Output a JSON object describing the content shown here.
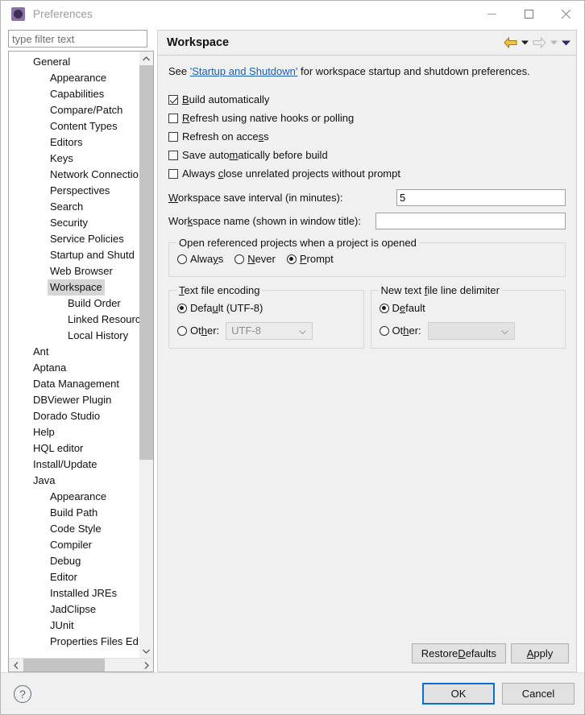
{
  "window": {
    "title": "Preferences",
    "app_icon": "preferences-gear-icon",
    "controls": {
      "minimize": "minimize-icon",
      "maximize": "maximize-icon",
      "close": "close-icon"
    }
  },
  "filter": {
    "placeholder": "type filter text",
    "value": ""
  },
  "tree": {
    "selected": "Workspace",
    "items": [
      {
        "label": "General",
        "level": 0
      },
      {
        "label": "Appearance",
        "level": 1
      },
      {
        "label": "Capabilities",
        "level": 1
      },
      {
        "label": "Compare/Patch",
        "level": 1
      },
      {
        "label": "Content Types",
        "level": 1
      },
      {
        "label": "Editors",
        "level": 1
      },
      {
        "label": "Keys",
        "level": 1
      },
      {
        "label": "Network Connectio",
        "level": 1
      },
      {
        "label": "Perspectives",
        "level": 1
      },
      {
        "label": "Search",
        "level": 1
      },
      {
        "label": "Security",
        "level": 1
      },
      {
        "label": "Service Policies",
        "level": 1
      },
      {
        "label": "Startup and Shutd",
        "level": 1
      },
      {
        "label": "Web Browser",
        "level": 1
      },
      {
        "label": "Workspace",
        "level": 1,
        "selected": true
      },
      {
        "label": "Build Order",
        "level": 2
      },
      {
        "label": "Linked Resourc",
        "level": 2
      },
      {
        "label": "Local History",
        "level": 2
      },
      {
        "label": "Ant",
        "level": 0
      },
      {
        "label": "Aptana",
        "level": 0
      },
      {
        "label": "Data Management",
        "level": 0
      },
      {
        "label": "DBViewer Plugin",
        "level": 0
      },
      {
        "label": "Dorado Studio",
        "level": 0
      },
      {
        "label": "Help",
        "level": 0
      },
      {
        "label": "HQL editor",
        "level": 0
      },
      {
        "label": "Install/Update",
        "level": 0
      },
      {
        "label": "Java",
        "level": 0
      },
      {
        "label": "Appearance",
        "level": 1
      },
      {
        "label": "Build Path",
        "level": 1
      },
      {
        "label": "Code Style",
        "level": 1
      },
      {
        "label": "Compiler",
        "level": 1
      },
      {
        "label": "Debug",
        "level": 1
      },
      {
        "label": "Editor",
        "level": 1
      },
      {
        "label": "Installed JREs",
        "level": 1
      },
      {
        "label": "JadClipse",
        "level": 1
      },
      {
        "label": "JUnit",
        "level": 1
      },
      {
        "label": "Properties Files Ed",
        "level": 1
      }
    ]
  },
  "page": {
    "title": "Workspace",
    "nav": {
      "back_icon": "back-arrow-icon",
      "back_caret_icon": "chevron-down-icon",
      "forward_icon": "forward-arrow-icon",
      "forward_caret_icon": "chevron-down-icon",
      "menu_caret_icon": "chevron-down-icon"
    },
    "intro": {
      "before": "See ",
      "link": "'Startup and Shutdown'",
      "after": " for workspace startup and shutdown preferences."
    },
    "checkboxes": [
      {
        "label_pre": "",
        "mnemonic": "B",
        "label_post": "uild automatically",
        "checked": true
      },
      {
        "label_pre": "",
        "mnemonic": "R",
        "label_post": "efresh using native hooks or polling",
        "checked": false
      },
      {
        "label_pre": "Refresh on acce",
        "mnemonic": "s",
        "label_post": "s",
        "checked": false
      },
      {
        "label_pre": "Save auto",
        "mnemonic": "m",
        "label_post": "atically before build",
        "checked": false
      },
      {
        "label_pre": "Always ",
        "mnemonic": "c",
        "label_post": "lose unrelated projects without prompt",
        "checked": false
      }
    ],
    "fields": [
      {
        "label_pre": "",
        "mnemonic": "W",
        "label_post": "orkspace save interval (in minutes):",
        "value": "5",
        "name": "workspace-save-interval"
      },
      {
        "label_pre": "Wor",
        "mnemonic": "k",
        "label_post": "space name (shown in window title):",
        "value": "",
        "name": "workspace-name"
      }
    ],
    "open_referenced": {
      "legend": "Open referenced projects when a project is opened",
      "options": [
        {
          "label_pre": "Alwa",
          "mnemonic": "y",
          "label_post": "s",
          "selected": false
        },
        {
          "label_pre": "",
          "mnemonic": "N",
          "label_post": "ever",
          "selected": false
        },
        {
          "label_pre": "",
          "mnemonic": "P",
          "label_post": "rompt",
          "selected": true
        }
      ]
    },
    "text_file_encoding": {
      "legend_pre": "",
      "legend_mnemonic": "T",
      "legend_post": "ext file encoding",
      "default": {
        "label_pre": "Defa",
        "mnemonic": "u",
        "label_post": "lt (UTF-8)",
        "selected": true
      },
      "other": {
        "label_pre": "Ot",
        "mnemonic": "h",
        "label_post": "er:",
        "selected": false
      },
      "combo_value": "UTF-8",
      "combo_disabled": true
    },
    "line_delimiter": {
      "legend_pre": "New text ",
      "legend_mnemonic": "f",
      "legend_post": "ile line delimiter",
      "default": {
        "label_pre": "D",
        "mnemonic": "e",
        "label_post": "fault",
        "selected": true
      },
      "other": {
        "label_pre": "Ot",
        "mnemonic": "h",
        "label_post": "er:",
        "selected": false
      },
      "combo_value": "",
      "combo_disabled": true
    },
    "buttons": {
      "restore_pre": "Restore ",
      "restore_mnemonic": "D",
      "restore_post": "efaults",
      "apply_pre": "",
      "apply_mnemonic": "A",
      "apply_post": "pply"
    }
  },
  "footer": {
    "help_icon": "help-question-icon",
    "ok": "OK",
    "cancel": "Cancel"
  },
  "colors": {
    "accent": "#0a6ed1",
    "link": "#1c5fb5",
    "panel": "#f0f0f0",
    "selection": "#d6d6d6",
    "back_arrow": "#e8a317"
  }
}
